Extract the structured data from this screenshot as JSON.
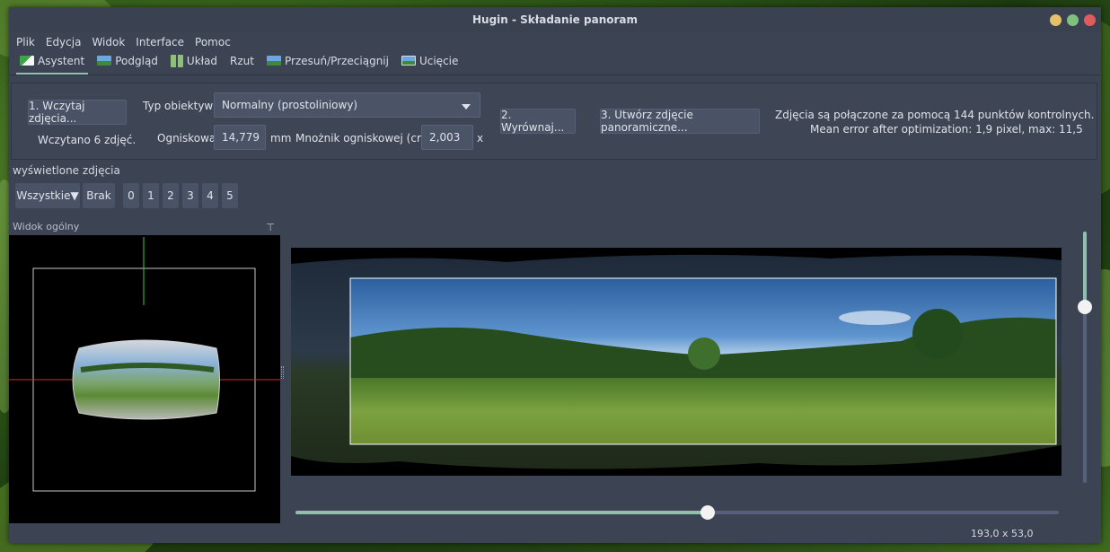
{
  "window": {
    "title": "Hugin - Składanie panoram"
  },
  "colors": {
    "accent": "#8fc0ad",
    "close": "#e05b5b",
    "maximize": "#7fbf7f",
    "minimize": "#e7c06a"
  },
  "menu": [
    "Plik",
    "Edycja",
    "Widok",
    "Interface",
    "Pomoc"
  ],
  "tabs": [
    {
      "label": "Asystent",
      "icon": "assistant-icon",
      "active": true
    },
    {
      "label": "Podgląd",
      "icon": "preview-gl-icon",
      "active": false
    },
    {
      "label": "Układ",
      "icon": "layout-icon",
      "active": false
    },
    {
      "label": "Rzut",
      "icon": "",
      "active": false
    },
    {
      "label": "Przesuń/Przeciągnij",
      "icon": "drag-icon",
      "active": false
    },
    {
      "label": "Ucięcie",
      "icon": "crop-icon",
      "active": false
    }
  ],
  "assistant": {
    "load_button": "1. Wczytaj zdjęcia...",
    "loaded_status": "Wczytano 6 zdjęć.",
    "lens_type_label": "Typ obiektywu:",
    "lens_type_value": "Normalny (prostoliniowy)",
    "focal_label": "Ogniskowa:",
    "focal_value": "14,779",
    "focal_unit": "mm",
    "crop_label": "Mnożnik ogniskowej (crop):",
    "crop_value": "2,003",
    "crop_unit": "x",
    "align_button": "2. Wyrównaj...",
    "create_button": "3. Utwórz zdjęcie panoramiczne...",
    "info_line1": "Zdjęcia są połączone za pomocą 144 punktów kontrolnych.",
    "info_line2": "Mean error after optimization: 1,9 pixel, max: 11,5"
  },
  "displayed": {
    "label": "wyświetlone zdjęcia",
    "all_button": "Wszystkie▼",
    "none_button": "Brak",
    "images": [
      "0",
      "1",
      "2",
      "3",
      "4",
      "5"
    ]
  },
  "overview": {
    "title": "Widok ogólny"
  },
  "sliders": {
    "horizontal_value": 0.54,
    "vertical_value": 0.3
  },
  "status": {
    "coords": "193,0 x 53,0"
  }
}
